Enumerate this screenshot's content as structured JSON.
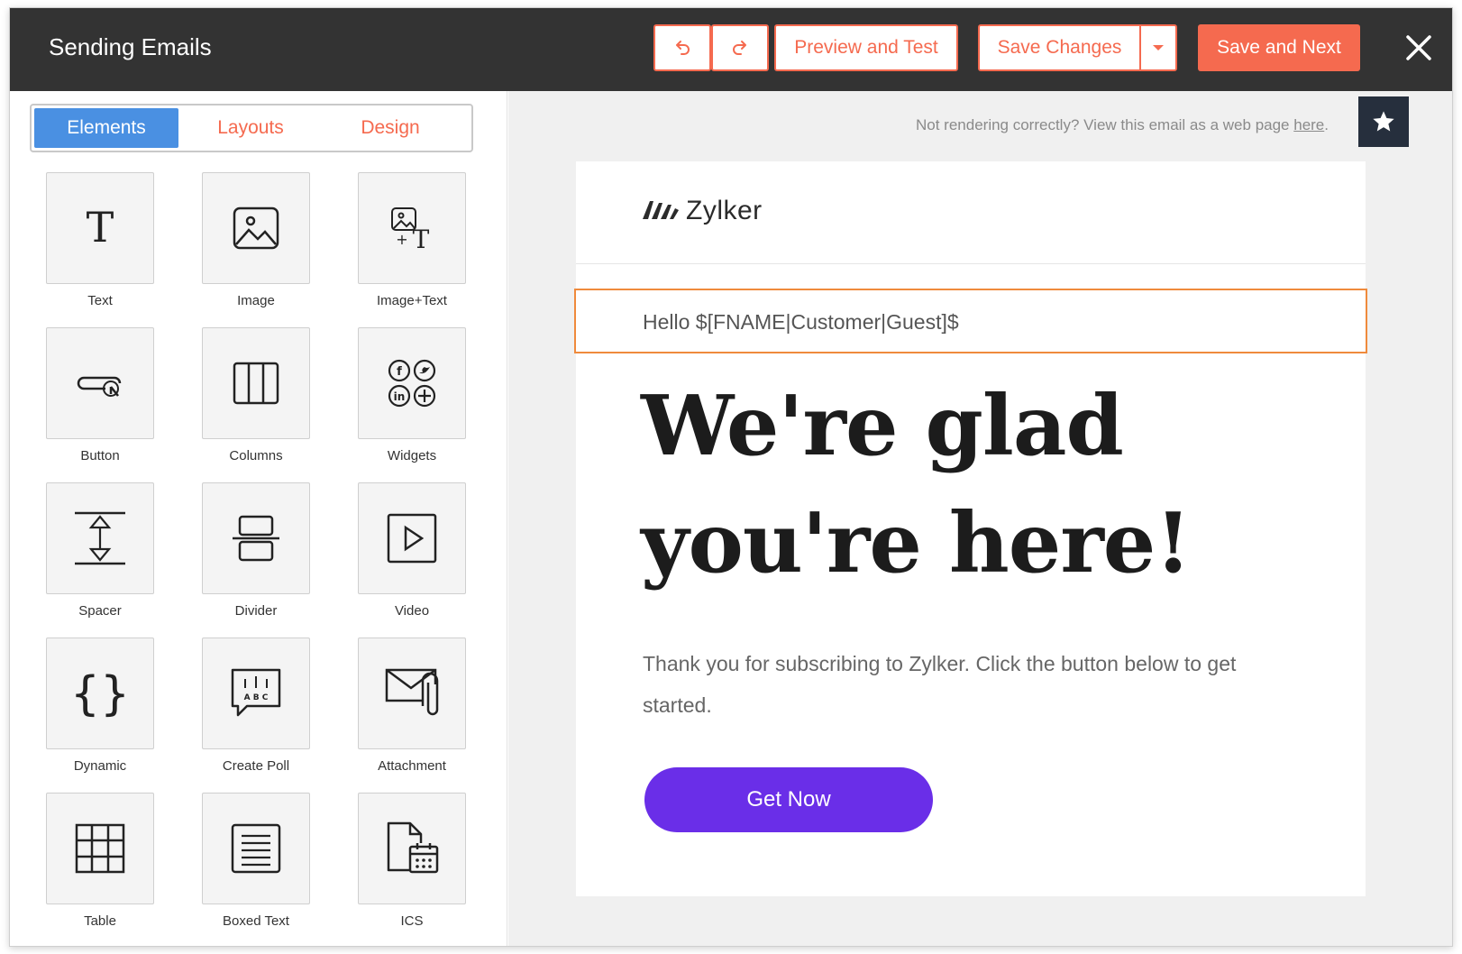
{
  "header": {
    "title": "Sending Emails",
    "preview_label": "Preview and Test",
    "save_label": "Save Changes",
    "save_next_label": "Save and Next"
  },
  "sidebar": {
    "tabs": [
      "Elements",
      "Layouts",
      "Design"
    ],
    "active_tab": "Elements",
    "elements": [
      {
        "label": "Text",
        "icon": "text-icon"
      },
      {
        "label": "Image",
        "icon": "image-icon"
      },
      {
        "label": "Image+Text",
        "icon": "image-text-icon"
      },
      {
        "label": "Button",
        "icon": "button-icon"
      },
      {
        "label": "Columns",
        "icon": "columns-icon"
      },
      {
        "label": "Widgets",
        "icon": "widgets-icon"
      },
      {
        "label": "Spacer",
        "icon": "spacer-icon"
      },
      {
        "label": "Divider",
        "icon": "divider-icon"
      },
      {
        "label": "Video",
        "icon": "video-icon"
      },
      {
        "label": "Dynamic",
        "icon": "dynamic-icon"
      },
      {
        "label": "Create Poll",
        "icon": "poll-icon"
      },
      {
        "label": "Attachment",
        "icon": "attachment-icon"
      },
      {
        "label": "Table",
        "icon": "table-icon"
      },
      {
        "label": "Boxed Text",
        "icon": "boxed-text-icon"
      },
      {
        "label": "ICS",
        "icon": "ics-icon"
      }
    ]
  },
  "canvas": {
    "render_note": "Not rendering correctly? View this email as a web page ",
    "render_link": "here",
    "render_note_end": "."
  },
  "email": {
    "logo_text": "Zylker",
    "greeting": "Hello $[FNAME|Customer|Guest]$",
    "headline_1": "We're glad",
    "headline_2": "you're here!",
    "body": "Thank you for subscribing to Zylker. Click the button below to get started.",
    "cta_label": "Get Now"
  },
  "colors": {
    "accent": "#f56a4f",
    "header_bg": "#333333",
    "tab_active": "#4a90e2",
    "cta": "#6a2ee8",
    "selection": "#ef8a3c"
  }
}
